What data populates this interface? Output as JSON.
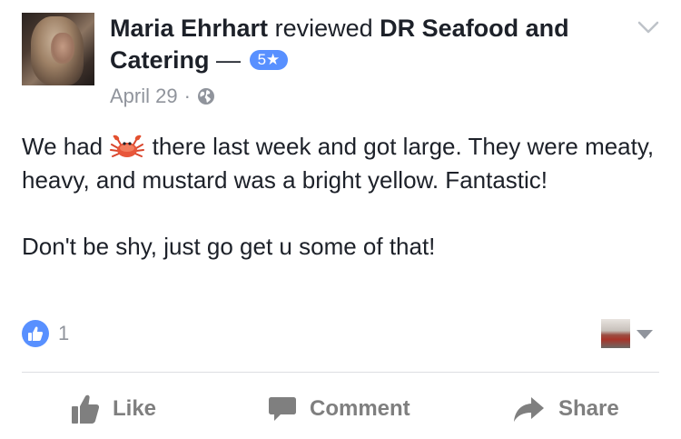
{
  "header": {
    "reviewer_name": "Maria Ehrhart",
    "verb": "reviewed",
    "page_name": "DR Seafood and Catering",
    "separator": "—",
    "rating_label": "5★"
  },
  "meta": {
    "date": "April 29",
    "dot": "·",
    "privacy_icon": "globe-icon"
  },
  "post": {
    "line1_before_emoji": "We had",
    "emoji": "crab-emoji",
    "line1_after_emoji": "there last week and got large.  They were meaty, heavy, and mustard was a bright yellow. Fantastic!",
    "paragraph2": "Don't be shy, just go get u some of that!"
  },
  "reactions": {
    "like_icon": "like-thumb-icon",
    "count": "1"
  },
  "actions": {
    "like": "Like",
    "comment": "Comment",
    "share": "Share"
  },
  "colors": {
    "accent": "#5890ff",
    "text": "#1d2129",
    "muted": "#90949c",
    "action_text": "#7f7f7f",
    "divider": "#dddfe2"
  }
}
